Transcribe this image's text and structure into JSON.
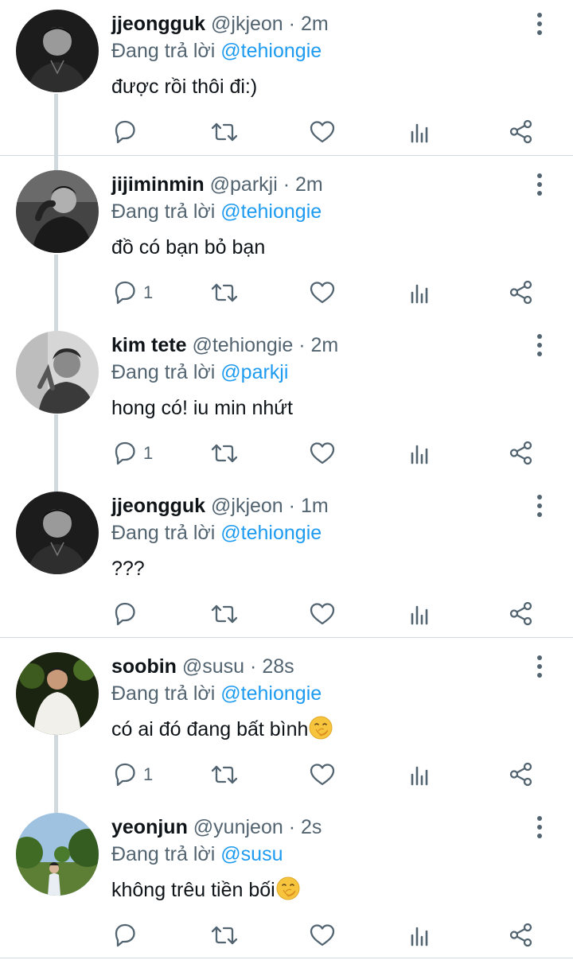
{
  "colors": {
    "accent": "#1d9bf0",
    "muted": "#536471",
    "text": "#0f1419",
    "divider": "#cfd9de"
  },
  "tweets": [
    {
      "name": "jjeongguk",
      "handle": "@jkjeon",
      "dot": "·",
      "time": "2m",
      "reply_prefix": "Đang trả lời",
      "reply_to": "@tehiongie",
      "text": "được rồi thôi đi:)",
      "reply_count": "",
      "avatar": "avatar-bw-man"
    },
    {
      "name": "jijiminmin",
      "handle": "@parkji",
      "dot": "·",
      "time": "2m",
      "reply_prefix": "Đang trả lời",
      "reply_to": "@tehiongie",
      "text": "đồ có bạn bỏ bạn",
      "reply_count": "1",
      "avatar": "avatar-bw-man-2"
    },
    {
      "name": "kim tete",
      "handle": "@tehiongie",
      "dot": "·",
      "time": "2m",
      "reply_prefix": "Đang trả lời",
      "reply_to": "@parkji",
      "text": "hong có! iu min nhứt",
      "reply_count": "1",
      "avatar": "avatar-bw-man-3"
    },
    {
      "name": "jjeongguk",
      "handle": "@jkjeon",
      "dot": "·",
      "time": "1m",
      "reply_prefix": "Đang trả lời",
      "reply_to": "@tehiongie",
      "text": "???",
      "reply_count": "",
      "avatar": "avatar-bw-man"
    },
    {
      "name": "soobin",
      "handle": "@susu",
      "dot": "·",
      "time": "28s",
      "reply_prefix": "Đang trả lời",
      "reply_to": "@tehiongie",
      "text": "có ai đó đang bất bình",
      "reply_count": "1",
      "avatar": "avatar-white-shirt",
      "emoji": "face-with-hand-over-mouth"
    },
    {
      "name": "yeonjun",
      "handle": "@yunjeon",
      "dot": "·",
      "time": "2s",
      "reply_prefix": "Đang trả lời",
      "reply_to": "@susu",
      "text": "không trêu tiền bối",
      "reply_count": "",
      "avatar": "avatar-park-photo",
      "emoji": "face-with-hand-over-mouth"
    }
  ]
}
